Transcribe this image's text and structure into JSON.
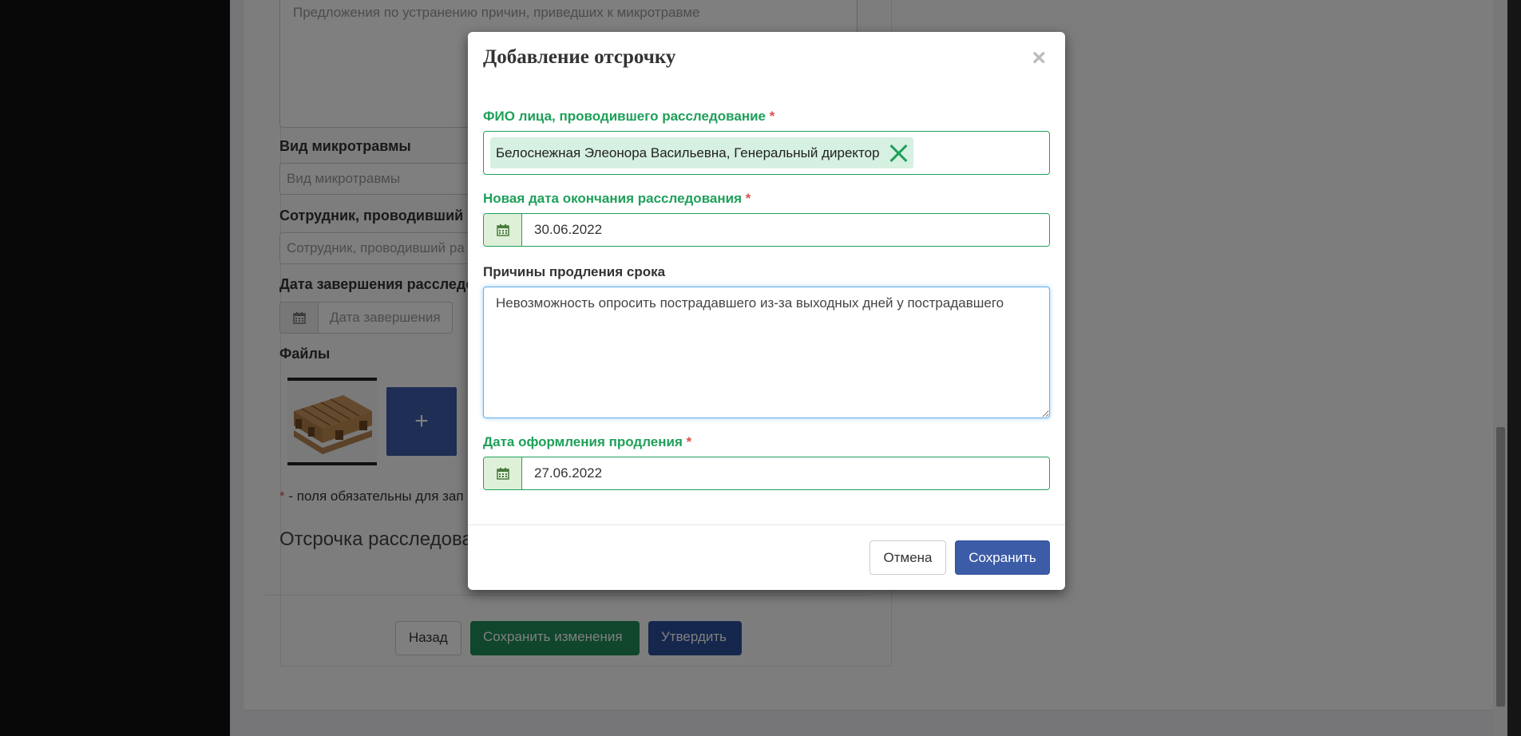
{
  "background": {
    "textarea_placeholder": "Предложения по устранению причин, приведших к микротравме",
    "injury_type_label": "Вид микротравмы",
    "injury_type_placeholder": "Вид микротравмы",
    "employee_label": "Сотрудник, проводивший р",
    "employee_placeholder": "Сотрудник, проводивший ра",
    "completion_date_label": "Дата завершения расследо",
    "completion_date_placeholder": "Дата завершения",
    "files_label": "Файлы",
    "add_file_label": "+",
    "required_note": "- поля обязательны для зап",
    "required_star": "*",
    "postponement_section_title": "Отсрочка расследова",
    "back_button": "Назад",
    "save_changes_button": "Сохранить изменения",
    "approve_button": "Утвердить"
  },
  "modal": {
    "title": "Добавление отсрочку",
    "close_symbol": "×",
    "investigator_label": "ФИО лица, проводившего расследование",
    "required_star": "*",
    "investigator_tag": "Белоснежная Элеонора Васильевна, Генеральный директор",
    "new_end_date_label": "Новая дата окончания расследования",
    "new_end_date_value": "30.06.2022",
    "reasons_label": "Причины продления срока",
    "reasons_value": "Невозможность опросить пострадавшего из-за выходных дней у пострадавшего",
    "extension_date_label": "Дата оформления продления",
    "extension_date_value": "27.06.2022",
    "cancel_button": "Отмена",
    "save_button": "Сохранить"
  }
}
